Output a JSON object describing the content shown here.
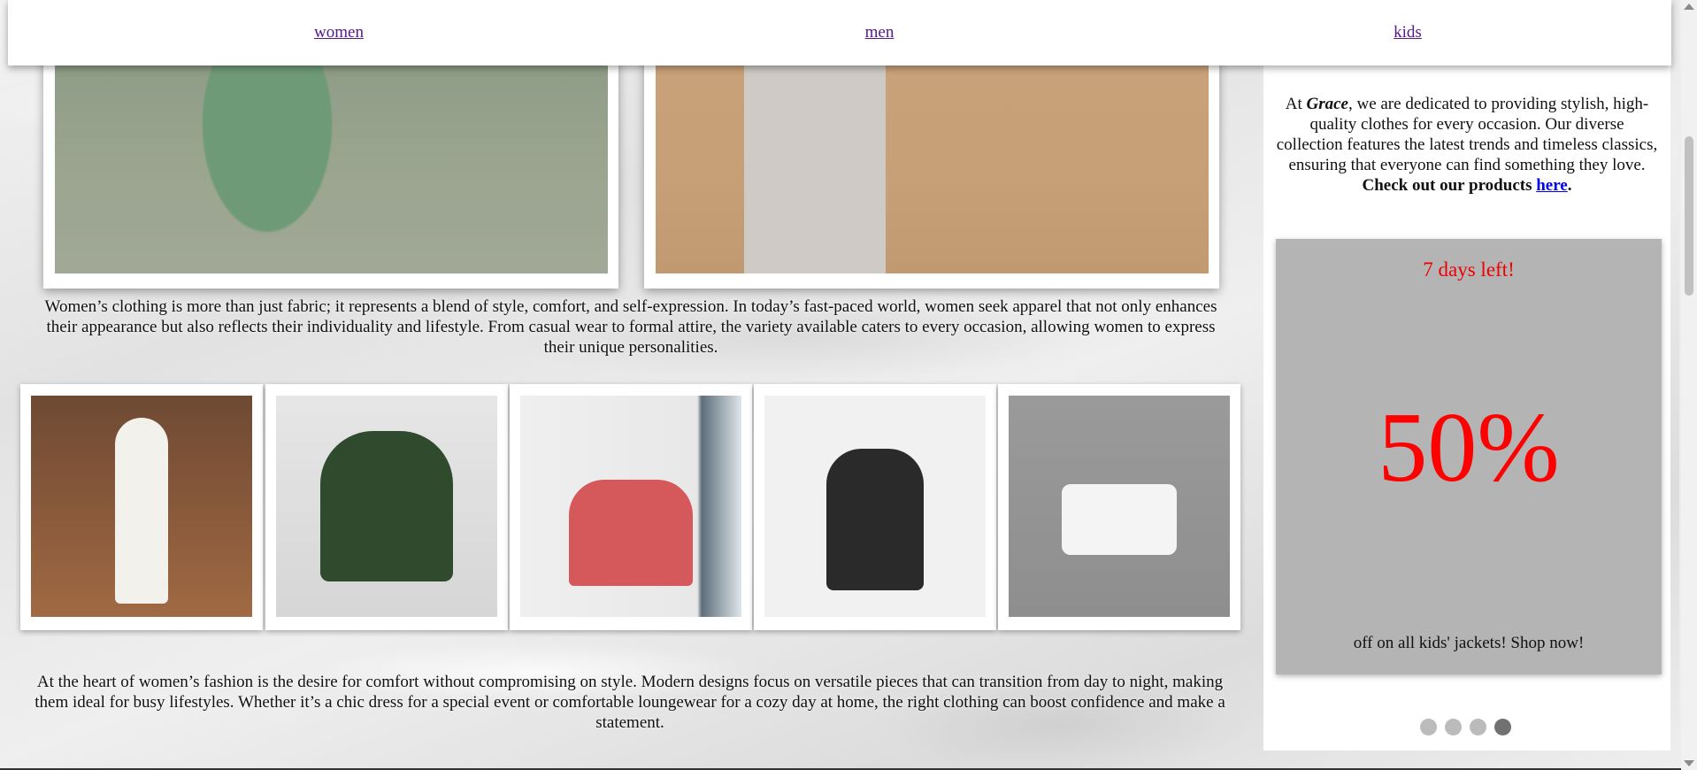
{
  "nav": {
    "links": [
      "women",
      "men",
      "kids"
    ]
  },
  "main": {
    "intro_paragraph": "Women’s clothing is more than just fabric; it represents a blend of style, comfort, and self-expression. In today’s fast-paced world, women seek apparel that not only enhances their appearance but also reflects their individuality and lifestyle. From casual wear to formal attire, the variety available caters to every occasion, allowing women to express their unique personalities.",
    "outro_paragraph": "At the heart of women’s fashion is the desire for comfort without compromising on style. Modern designs focus on versatile pieces that can transition from day to night, making them ideal for busy lifestyles. Whether it’s a chic dress for a special event or comfortable loungewear for a cozy day at home, the right clothing can boost confidence and make a statement."
  },
  "sidebar": {
    "about_prefix": "At ",
    "brand": "Grace",
    "about_middle": ", we are dedicated to providing stylish, high-quality clothes for every occasion. Our diverse collection features the latest trends and timeless classics, ensuring that everyone can find something they love. ",
    "about_cta": "Check out our products ",
    "about_link": "here",
    "about_end": ".",
    "promo": {
      "days_left": "7 days left!",
      "discount": "50%",
      "offer_text": "off on all kids' jackets! Shop now!"
    },
    "slides": {
      "count": 4,
      "active_index": 3
    }
  },
  "colors": {
    "promo_text": "#ff0000",
    "promo_bg": "#b4b4b4",
    "link_visited": "#551a8b",
    "link": "#0000ee"
  }
}
